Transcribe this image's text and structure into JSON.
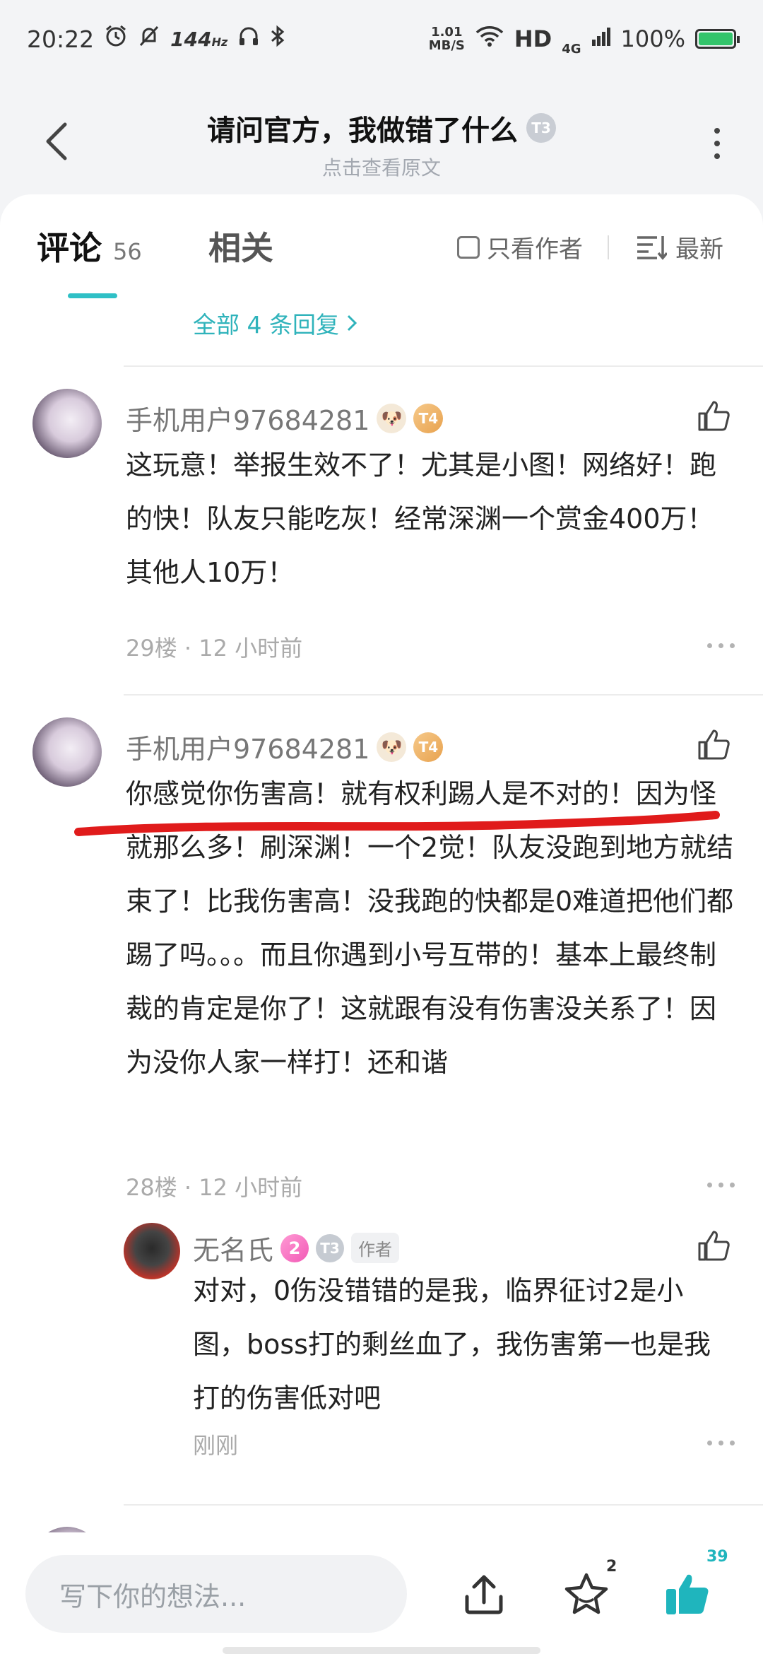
{
  "status_bar": {
    "time": "20:22",
    "refresh_rate": "144",
    "refresh_unit": "Hz",
    "net_speed_value": "1.01",
    "net_speed_unit": "MB/S",
    "hd_label": "HD",
    "network_type": "4G",
    "battery": "100%"
  },
  "header": {
    "title": "请问官方，我做错了什么",
    "title_badge": "T3",
    "subtitle": "点击查看原文"
  },
  "tabs": {
    "comment_label": "评论",
    "comment_count": "56",
    "related_label": "相关",
    "author_only_label": "只看作者",
    "sort_label": "最新"
  },
  "all_replies_link": "全部 4 条回复",
  "comments": [
    {
      "username": "手机用户97684281",
      "level_badge": "T4",
      "text": "这玩意！举报生效不了！尤其是小图！网络好！跑的快！队友只能吃灰！经常深渊一个赏金400万！其他人10万！",
      "floor_time": "29楼 · 12 小时前"
    },
    {
      "username": "手机用户97684281",
      "level_badge": "T4",
      "text": "你感觉你伤害高！就有权利踢人是不对的！因为怪就那么多！刷深渊！一个2觉！队友没跑到地方就结束了！比我伤害高！没我跑的快都是0难道把他们都踢了吗。。。而且你遇到小号互带的！基本上最终制裁的肯定是你了！这就跟有没有伤害没关系了！因为没你人家一样打！还和谐",
      "floor_time": "28楼 · 12 小时前"
    }
  ],
  "reply": {
    "username": "无名氏",
    "pink_badge": "2",
    "grey_badge": "T3",
    "author_tag": "作者",
    "text": "对对，0伤没错错的是我，临界征讨2是小图，boss打的剩丝血了，我伤害第一也是我打的伤害低对吧",
    "time": "刚刚"
  },
  "bottom_bar": {
    "input_placeholder": "写下你的想法...",
    "favorite_count": "2",
    "like_count": "39"
  },
  "colors": {
    "accent": "#2fc0c6",
    "like_active": "#1fb5bd",
    "annotation_red": "#e01b1b"
  }
}
